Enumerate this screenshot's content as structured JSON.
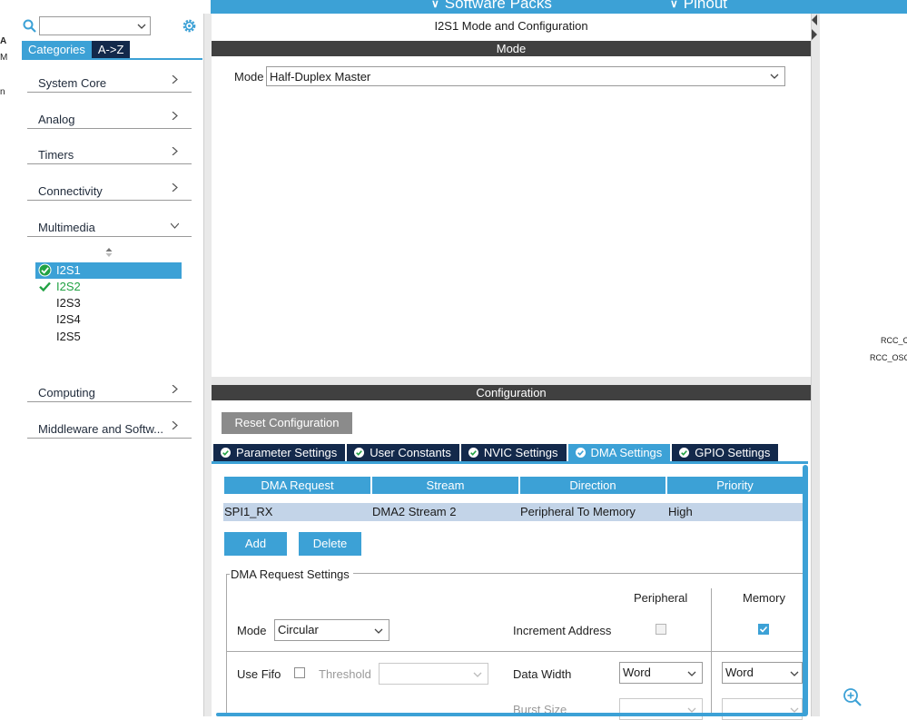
{
  "topbar": {
    "software_packs": "Software Packs",
    "pinout": "Pinout"
  },
  "gutter": {
    "fragments": [
      "A",
      "M",
      "n"
    ]
  },
  "sidebar": {
    "search_value": "",
    "tabs": [
      "Categories",
      "A->Z"
    ],
    "categories": [
      {
        "label": "System Core"
      },
      {
        "label": "Analog"
      },
      {
        "label": "Timers"
      },
      {
        "label": "Connectivity"
      },
      {
        "label": "Multimedia"
      },
      {
        "label": "Computing"
      },
      {
        "label": "Middleware and Softw..."
      }
    ],
    "multimedia_items": [
      {
        "label": "I2S1",
        "state": "selected"
      },
      {
        "label": "I2S2",
        "state": "configured"
      },
      {
        "label": "I2S3",
        "state": "none"
      },
      {
        "label": "I2S4",
        "state": "none"
      },
      {
        "label": "I2S5",
        "state": "none"
      }
    ]
  },
  "main": {
    "title": "I2S1 Mode and Configuration",
    "mode_section": "Mode",
    "mode_label": "Mode",
    "mode_value": "Half-Duplex Master",
    "config_section": "Configuration",
    "reset_button": "Reset Configuration",
    "config_tabs": [
      {
        "label": "Parameter Settings"
      },
      {
        "label": "User Constants"
      },
      {
        "label": "NVIC Settings"
      },
      {
        "label": "DMA Settings",
        "active": true
      },
      {
        "label": "GPIO Settings"
      }
    ],
    "dma_table": {
      "headers": [
        "DMA Request",
        "Stream",
        "Direction",
        "Priority"
      ],
      "rows": [
        [
          "SPI1_RX",
          "DMA2 Stream 2",
          "Peripheral To Memory",
          "High"
        ]
      ]
    },
    "add_button": "Add",
    "delete_button": "Delete",
    "dma_request_settings": {
      "title": "DMA Request Settings",
      "peripheral_header": "Peripheral",
      "memory_header": "Memory",
      "mode_label": "Mode",
      "mode_value": "Circular",
      "increment_address_label": "Increment Address",
      "peripheral_increment": false,
      "memory_increment": true,
      "use_fifo_label": "Use Fifo",
      "use_fifo": false,
      "threshold_label": "Threshold",
      "threshold_value": "",
      "data_width_label": "Data Width",
      "peripheral_data_width": "Word",
      "memory_data_width": "Word",
      "burst_size_label": "Burst Size"
    }
  },
  "right_panel": {
    "labels": [
      "RCC_C",
      "RCC_OSC"
    ]
  },
  "colors": {
    "accent": "#3ca1d6",
    "dark_navy": "#13294b",
    "section_bar": "#404040",
    "configured_green": "#22a244",
    "table_row": "#c3d4e8"
  }
}
